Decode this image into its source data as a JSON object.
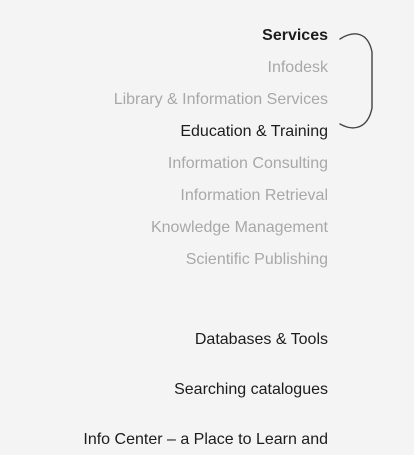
{
  "nav": {
    "services_label": "Services",
    "services_items": [
      {
        "label": "Infodesk"
      },
      {
        "label": "Library & Information Services"
      },
      {
        "label": "Education & Training"
      },
      {
        "label": "Information Consulting"
      },
      {
        "label": "Information Retrieval"
      },
      {
        "label": "Knowledge Management"
      },
      {
        "label": "Scientific Publishing"
      }
    ],
    "databases_label": "Databases & Tools",
    "searching_label": "Searching catalogues",
    "info_center_label": "Info Center – a Place to Learn and"
  },
  "colors": {
    "background": "#f4f4f4",
    "active_text": "#1c1c1c",
    "inactive_text": "#a8a8a8",
    "bracket": "#444444"
  },
  "icons": {
    "bracket": "curly-bracket-indicator"
  }
}
